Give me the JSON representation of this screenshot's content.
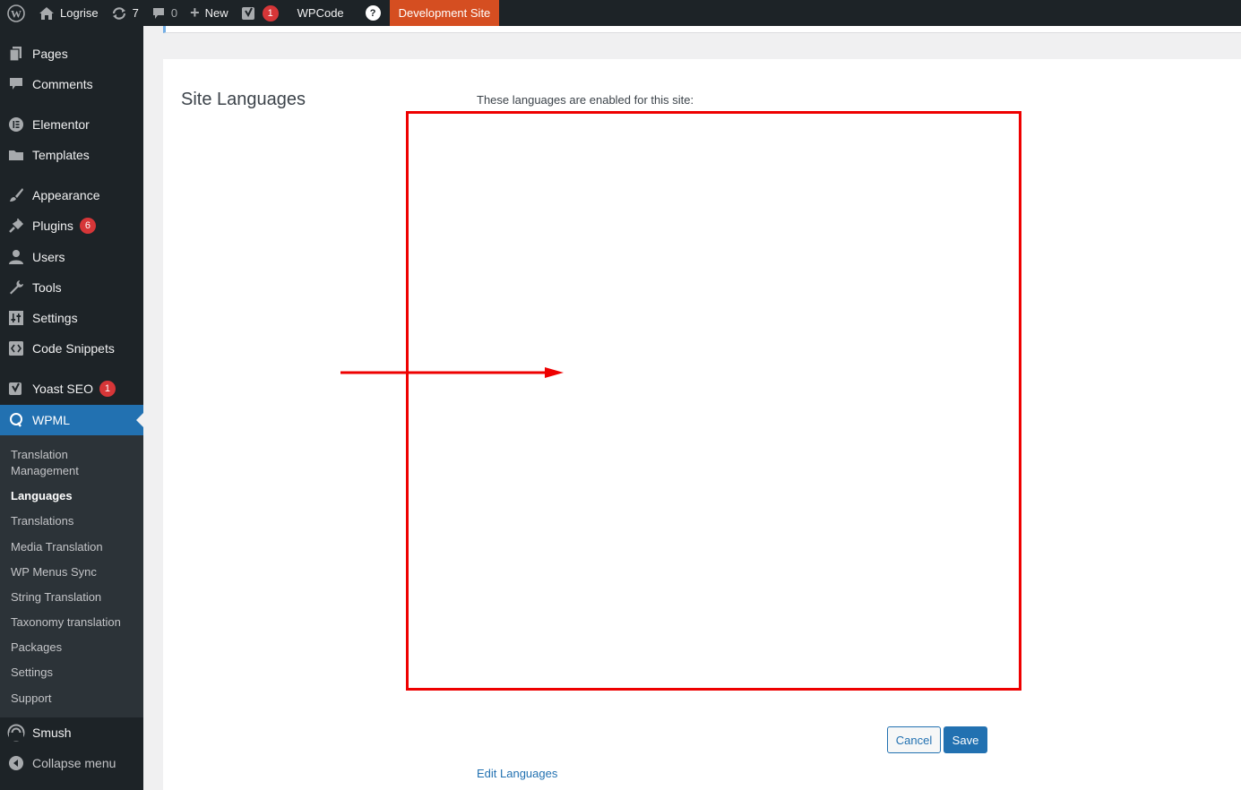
{
  "adminbar": {
    "site_name": "Logrise",
    "updates_count": "7",
    "comments_count": "0",
    "new_label": "New",
    "yoast_badge": "1",
    "wpcode_label": "WPCode",
    "help_label": "?",
    "dev_site_label": "Development Site"
  },
  "sidebar": {
    "items": [
      {
        "label": "Pages",
        "icon": "pages-icon"
      },
      {
        "label": "Comments",
        "icon": "comment-icon"
      },
      {
        "label": "Elementor",
        "icon": "elementor-icon"
      },
      {
        "label": "Templates",
        "icon": "folder-icon"
      },
      {
        "label": "Appearance",
        "icon": "brush-icon"
      },
      {
        "label": "Plugins",
        "icon": "plug-icon",
        "badge": "6"
      },
      {
        "label": "Users",
        "icon": "user-icon"
      },
      {
        "label": "Tools",
        "icon": "wrench-icon"
      },
      {
        "label": "Settings",
        "icon": "settings-icon"
      },
      {
        "label": "Code Snippets",
        "icon": "code-icon"
      },
      {
        "label": "Yoast SEO",
        "icon": "yoast-icon",
        "badge": "1"
      },
      {
        "label": "WPML",
        "icon": "wpml-icon"
      },
      {
        "label": "Smush",
        "icon": "smush-icon"
      },
      {
        "label": "Collapse menu",
        "icon": "collapse-icon"
      }
    ],
    "wpml_submenu": [
      "Translation Management",
      "Languages",
      "Translations",
      "Media Translation",
      "WP Menus Sync",
      "String Translation",
      "Taxonomy translation",
      "Packages",
      "Settings",
      "Support"
    ]
  },
  "main": {
    "section_title": "Site Languages",
    "enabled_text": "These languages are enabled for this site:",
    "cancel_label": "Cancel",
    "save_label": "Save",
    "edit_languages_label": "Edit Languages"
  },
  "colors": {
    "admin_dark": "#1d2327",
    "accent_blue": "#2271b1",
    "badge_red": "#d63638",
    "dev_site_orange": "#d54e21",
    "annotation_red": "#ee0000"
  }
}
